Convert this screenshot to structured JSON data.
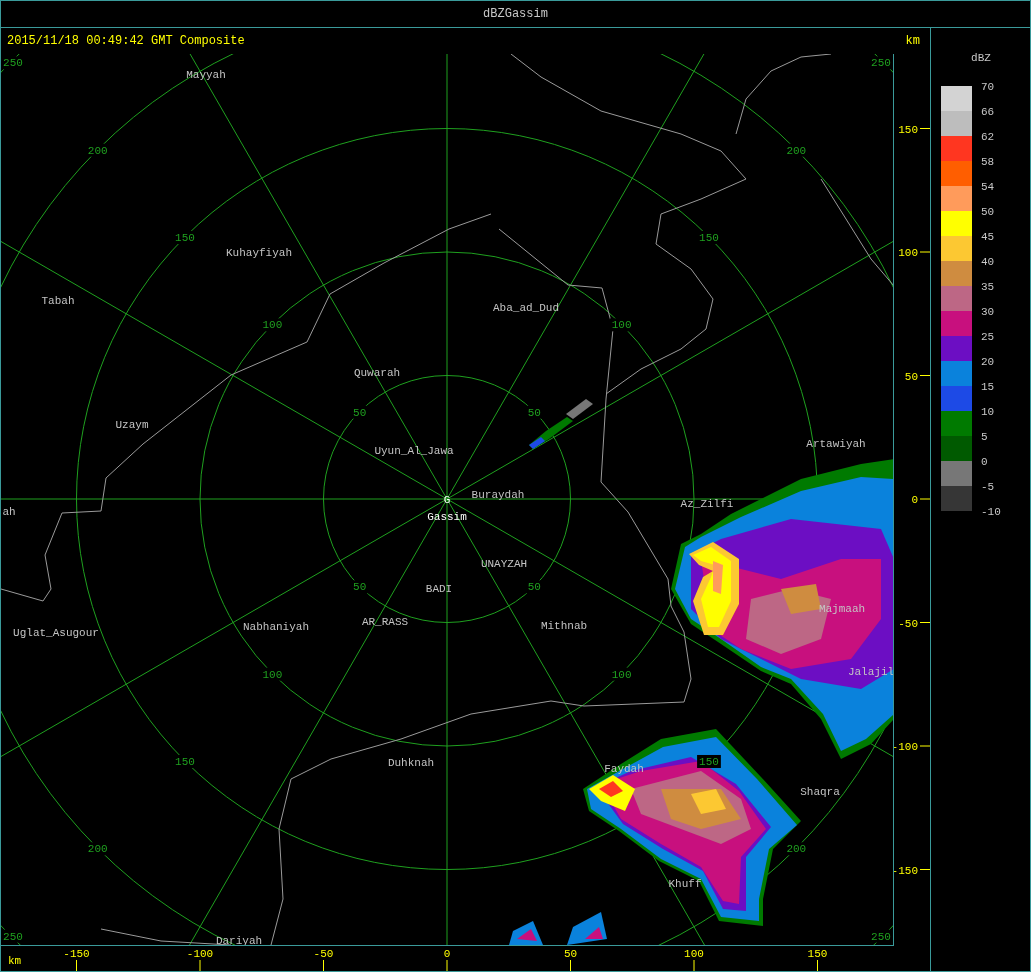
{
  "window": {
    "title": "dBZGassim"
  },
  "header": {
    "timestamp": "2015/11/18 00:49:42 GMT Composite",
    "unit": "km"
  },
  "radar": {
    "site_marker": "G",
    "site_name": "Gassim",
    "range_rings": [
      {
        "labels": [
          "50",
          "50",
          "50",
          "50"
        ]
      },
      {
        "labels": [
          "100",
          "100",
          "100",
          "100"
        ]
      },
      {
        "labels": [
          "150",
          "150",
          "150",
          "150"
        ]
      },
      {
        "labels": [
          "200",
          "200",
          "200",
          "200"
        ]
      },
      {
        "labels": [
          "250",
          "250",
          "250",
          "250"
        ]
      }
    ],
    "places": [
      {
        "name": "Mayyah"
      },
      {
        "name": "Kuhayfiyah"
      },
      {
        "name": "Tabah"
      },
      {
        "name": "Aba_ad_Dud"
      },
      {
        "name": "Quwarah"
      },
      {
        "name": "Uzaym"
      },
      {
        "name": "Uyun_Al_Jawa"
      },
      {
        "name": "Artawiyah"
      },
      {
        "name": "Buraydah"
      },
      {
        "name": "ah"
      },
      {
        "name": "Az_Zilfi"
      },
      {
        "name": "UNAYZAH"
      },
      {
        "name": "BADI"
      },
      {
        "name": "Majmaah"
      },
      {
        "name": "Uglat_Asugour"
      },
      {
        "name": "Nabhaniyah"
      },
      {
        "name": "AR_RASS"
      },
      {
        "name": "Mithnab"
      },
      {
        "name": "Jalajil"
      },
      {
        "name": "Duhknah"
      },
      {
        "name": "Faydah"
      },
      {
        "name": "Shaqra"
      },
      {
        "name": "Khuff"
      },
      {
        "name": "Dariyah"
      }
    ]
  },
  "y_axis": {
    "ticks": [
      "150",
      "100",
      "50",
      "0",
      "-50",
      "-100",
      "-150"
    ]
  },
  "x_axis": {
    "unit": "km",
    "ticks": [
      "-150",
      "-100",
      "-50",
      "0",
      "50",
      "100",
      "150"
    ]
  },
  "legend": {
    "title": "dBZ",
    "bins": [
      {
        "color": "#d3d3d3"
      },
      {
        "color": "#bdbdbd"
      },
      {
        "color": "#ff3620"
      },
      {
        "color": "#ff5e00"
      },
      {
        "color": "#ff9b5b"
      },
      {
        "color": "#ffff00"
      },
      {
        "color": "#fcc832"
      },
      {
        "color": "#cf8c40"
      },
      {
        "color": "#bd6785"
      },
      {
        "color": "#c8107e"
      },
      {
        "color": "#6c0ec3"
      },
      {
        "color": "#0a82dc"
      },
      {
        "color": "#1d4ae6"
      },
      {
        "color": "#007a00"
      },
      {
        "color": "#005a00"
      },
      {
        "color": "#777777"
      },
      {
        "color": "#363636"
      }
    ],
    "labels": [
      "70",
      "66",
      "62",
      "58",
      "54",
      "50",
      "45",
      "40",
      "35",
      "30",
      "25",
      "20",
      "15",
      "10",
      "5",
      "0",
      "-5",
      "-10"
    ]
  }
}
